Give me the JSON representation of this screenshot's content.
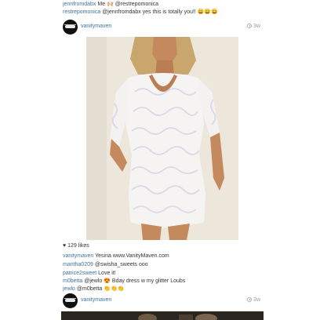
{
  "top_comments": [
    {
      "user": "jennfromdabx",
      "text": "Me 🙌🏼 @restrepomonica"
    },
    {
      "user": "restrepomonica",
      "text": "@jennfromdabx yes this is totally you!! 😄😄😄"
    }
  ],
  "post1": {
    "username": "vanitymaven",
    "time": "3w",
    "photo_icon": "photo-of-woman-in-white-lace-dress",
    "likes": "129 likes",
    "comments": [
      {
        "user": "vanitymaven",
        "text": "Yesina www.VanityMaven.com"
      },
      {
        "user": "mantha0209",
        "text": "@swisha_sweets ooo"
      },
      {
        "user": "patrice2sweet",
        "text": "Love it!"
      },
      {
        "user": "m0betta",
        "text": "@jewlo 😍 Bday dress w my glitter Loubs"
      },
      {
        "user": "jewlo",
        "text": "@m0betta 👏👏👏"
      }
    ]
  },
  "post2": {
    "username": "vanitymaven",
    "time": "3w"
  },
  "colors": {
    "username_link": "#3f729b",
    "text": "#333333",
    "muted": "#999999"
  }
}
